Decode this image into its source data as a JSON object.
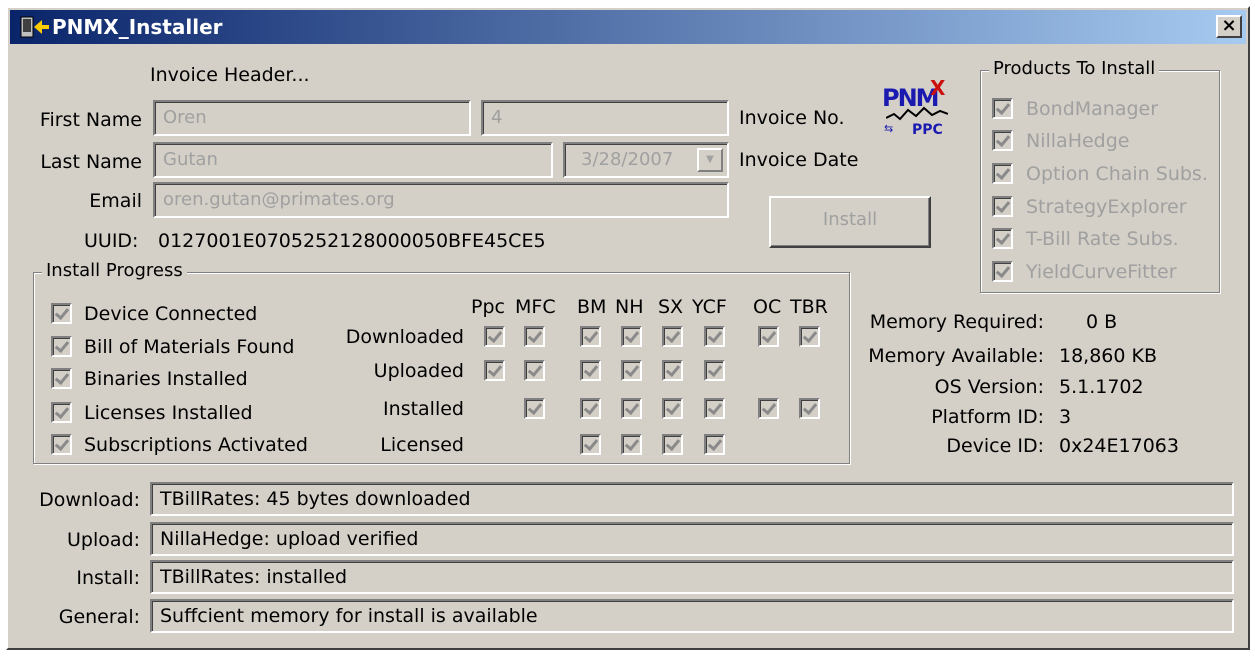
{
  "window": {
    "title": "PNMX_Installer",
    "close_glyph": "×"
  },
  "invoice": {
    "header": "Invoice Header...",
    "first_name_label": "First Name",
    "first_name": "Oren",
    "invoice_no_value": "4",
    "invoice_no_label": "Invoice No.",
    "last_name_label": "Last Name",
    "last_name": "Gutan",
    "invoice_date": "3/28/2007",
    "invoice_date_label": "Invoice Date",
    "email_label": "Email",
    "email": "oren.gutan@primates.org",
    "uuid_label": "UUID:",
    "uuid": "0127001E0705252128000050BFE45CE5"
  },
  "install_button": "Install",
  "logo": {
    "text": "PNM",
    "x": "X",
    "sub": "PPC"
  },
  "products": {
    "title": "Products To Install",
    "items": [
      {
        "label": "BondManager",
        "checked": true
      },
      {
        "label": "NillaHedge",
        "checked": true
      },
      {
        "label": "Option Chain Subs.",
        "checked": true
      },
      {
        "label": "StrategyExplorer",
        "checked": true
      },
      {
        "label": "T-Bill Rate Subs.",
        "checked": true
      },
      {
        "label": "YieldCurveFitter",
        "checked": true
      }
    ]
  },
  "progress": {
    "title": "Install Progress",
    "steps": [
      {
        "label": "Device Connected",
        "checked": true
      },
      {
        "label": "Bill of Materials Found",
        "checked": true
      },
      {
        "label": "Binaries Installed",
        "checked": true
      },
      {
        "label": "Licenses Installed",
        "checked": true
      },
      {
        "label": "Subscriptions Activated",
        "checked": true
      }
    ],
    "columns": [
      "Ppc",
      "MFC",
      "BM",
      "NH",
      "SX",
      "YCF",
      "OC",
      "TBR"
    ],
    "rows": [
      {
        "label": "Downloaded",
        "cells": [
          true,
          true,
          true,
          true,
          true,
          true,
          true,
          true
        ]
      },
      {
        "label": "Uploaded",
        "cells": [
          true,
          true,
          true,
          true,
          true,
          true,
          false,
          false
        ]
      },
      {
        "label": "Installed",
        "cells": [
          false,
          true,
          true,
          true,
          true,
          true,
          true,
          true
        ]
      },
      {
        "label": "Licensed",
        "cells": [
          false,
          false,
          true,
          true,
          true,
          true,
          false,
          false
        ]
      }
    ]
  },
  "system": {
    "memory_required_label": "Memory Required:",
    "memory_required": "0 B",
    "memory_available_label": "Memory Available:",
    "memory_available": "18,860 KB",
    "os_version_label": "OS Version:",
    "os_version": "5.1.1702",
    "platform_id_label": "Platform ID:",
    "platform_id": "3",
    "device_id_label": "Device ID:",
    "device_id": "0x24E17063"
  },
  "status": {
    "download_label": "Download:",
    "download": "TBillRates: 45 bytes downloaded",
    "upload_label": "Upload:",
    "upload": "NillaHedge: upload verified",
    "install_label": "Install:",
    "install": "TBillRates: installed",
    "general_label": "General:",
    "general": "Suffcient memory for install is available"
  }
}
